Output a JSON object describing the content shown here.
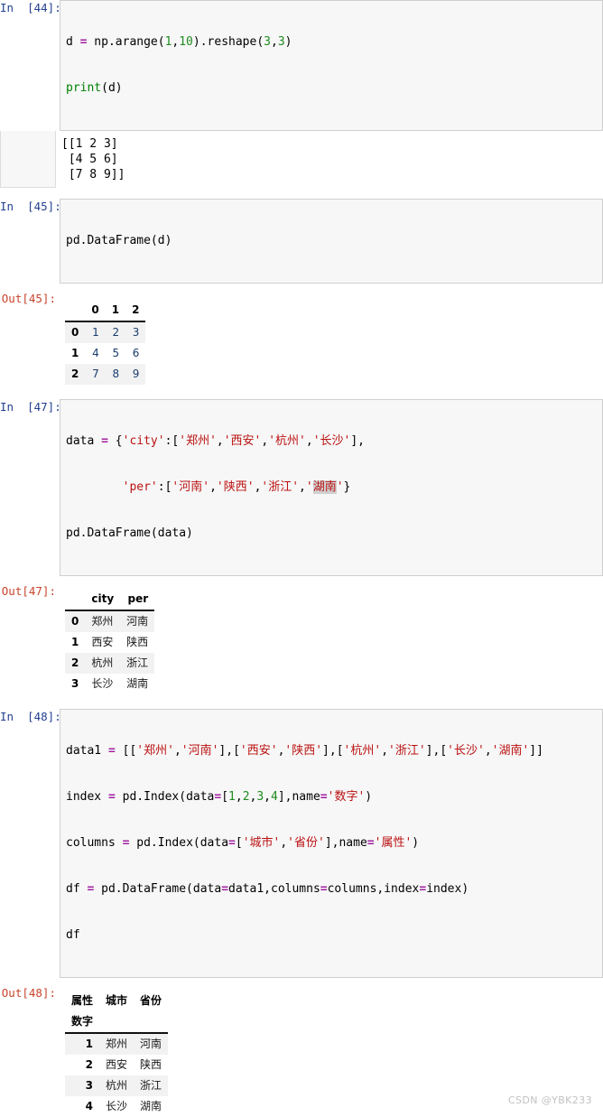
{
  "cells": [
    {
      "id": "cell-44",
      "in_prompt": "In  [44]:",
      "code_lines": [
        "d = np.arange(1,10).reshape(3,3)",
        "print(d)"
      ],
      "stream_output": "[[1 2 3]\n [4 5 6]\n [7 8 9]]"
    },
    {
      "id": "cell-45",
      "in_prompt": "In  [45]:",
      "out_prompt": "Out[45]:",
      "code_lines": [
        "pd.DataFrame(d)"
      ],
      "table": {
        "columns": [
          "0",
          "1",
          "2"
        ],
        "rows": [
          {
            "index": "0",
            "values": [
              "1",
              "2",
              "3"
            ]
          },
          {
            "index": "1",
            "values": [
              "4",
              "5",
              "6"
            ]
          },
          {
            "index": "2",
            "values": [
              "7",
              "8",
              "9"
            ]
          }
        ]
      }
    },
    {
      "id": "cell-47",
      "in_prompt": "In  [47]:",
      "out_prompt": "Out[47]:",
      "code_lines": [
        "data = {'city':['郑州','西安','杭州','长沙'],",
        "        'per':['河南','陕西','浙江','湖南'}",
        "pd.DataFrame(data)"
      ],
      "table": {
        "columns": [
          "city",
          "per"
        ],
        "rows": [
          {
            "index": "0",
            "values": [
              "郑州",
              "河南"
            ]
          },
          {
            "index": "1",
            "values": [
              "西安",
              "陕西"
            ]
          },
          {
            "index": "2",
            "values": [
              "杭州",
              "浙江"
            ]
          },
          {
            "index": "3",
            "values": [
              "长沙",
              "湖南"
            ]
          }
        ]
      }
    },
    {
      "id": "cell-48",
      "in_prompt": "In  [48]:",
      "out_prompt": "Out[48]:",
      "code_lines": [
        "data1 = [['郑州','河南'],['西安','陕西'],['杭州','浙江'],['长沙','湖南']]",
        "index = pd.Index(data=[1,2,3,4],name='数字')",
        "columns = pd.Index(data=['城市','省份'],name='属性')",
        "df = pd.DataFrame(data=data1,columns=columns,index=index)",
        "df"
      ],
      "table": {
        "columns_name": "属性",
        "index_name": "数字",
        "columns": [
          "城市",
          "省份"
        ],
        "rows": [
          {
            "index": "1",
            "values": [
              "郑州",
              "河南"
            ]
          },
          {
            "index": "2",
            "values": [
              "西安",
              "陕西"
            ]
          },
          {
            "index": "3",
            "values": [
              "杭州",
              "浙江"
            ]
          },
          {
            "index": "4",
            "values": [
              "长沙",
              "湖南"
            ]
          }
        ]
      }
    }
  ],
  "watermark": "CSDN @YBK233",
  "colors": {
    "in_prompt": "#213f8f",
    "out_prompt": "#c8442c",
    "string": "#bb1111",
    "number": "#1e8b1e",
    "operator": "#a020a0",
    "builtin": "#008000",
    "code_bg": "#f7f7f7",
    "row_stripe": "#f2f2f2",
    "watermark": "#c2c2c2"
  }
}
